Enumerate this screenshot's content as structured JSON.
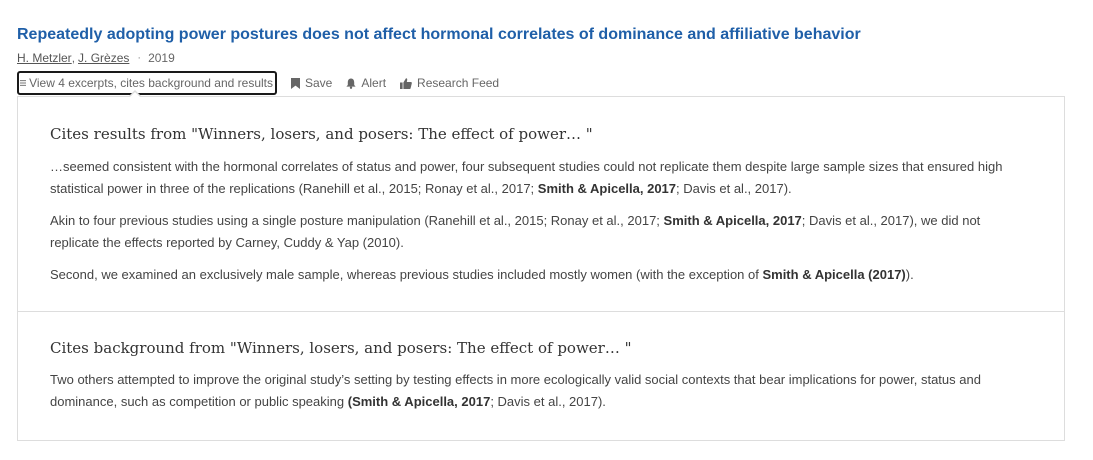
{
  "paper": {
    "title": "Repeatedly adopting power postures does not affect hormonal correlates of dominance and affiliative behavior",
    "authors": [
      "H. Metzler",
      "J. Grèzes"
    ],
    "author_separator": ",",
    "year": "2019"
  },
  "actions": {
    "excerpts_toggle": "View 4 excerpts, cites background and results",
    "save": "Save",
    "alert": "Alert",
    "research_feed": "Research Feed"
  },
  "colors": {
    "title_link": "#1f5fa8",
    "toggle_border": "#1a1a1a",
    "panel_border": "#dddddd"
  },
  "icons": {
    "excerpts": "list-icon",
    "save": "bookmark-icon",
    "alert": "bell-icon",
    "research_feed": "thumbs-up-icon"
  },
  "sections": [
    {
      "heading": "Cites results from \"Winners, losers, and posers: The effect of power… \"",
      "excerpts": [
        {
          "parts": [
            {
              "text": "…seemed consistent with the hormonal correlates of status and power, four subsequent studies could not replicate them despite large sample sizes that ensured high statistical power in three of the replications (Ranehill et al., 2015; Ronay et al., 2017; ",
              "bold": false
            },
            {
              "text": "Smith & Apicella, 2017",
              "bold": true
            },
            {
              "text": "; Davis et al., 2017).",
              "bold": false
            }
          ]
        },
        {
          "parts": [
            {
              "text": "Akin to four previous studies using a single posture manipulation (Ranehill et al., 2015; Ronay et al., 2017; ",
              "bold": false
            },
            {
              "text": "Smith & Apicella, 2017",
              "bold": true
            },
            {
              "text": "; Davis et al., 2017), we did not replicate the effects reported by Carney, Cuddy & Yap (2010).",
              "bold": false
            }
          ]
        },
        {
          "parts": [
            {
              "text": "Second, we examined an exclusively male sample, whereas previous studies included mostly women (with the exception of ",
              "bold": false
            },
            {
              "text": "Smith & Apicella (2017)",
              "bold": true
            },
            {
              "text": ").",
              "bold": false
            }
          ]
        }
      ]
    },
    {
      "heading": "Cites background from \"Winners, losers, and posers: The effect of power… \"",
      "excerpts": [
        {
          "parts": [
            {
              "text": "Two others attempted to improve the original study’s setting by testing effects in more ecologically valid social contexts that bear implications for power, status and dominance, such as competition or public speaking ",
              "bold": false
            },
            {
              "text": "(Smith & Apicella, 2017",
              "bold": true
            },
            {
              "text": "; Davis et al., 2017).",
              "bold": false
            }
          ]
        }
      ]
    }
  ]
}
